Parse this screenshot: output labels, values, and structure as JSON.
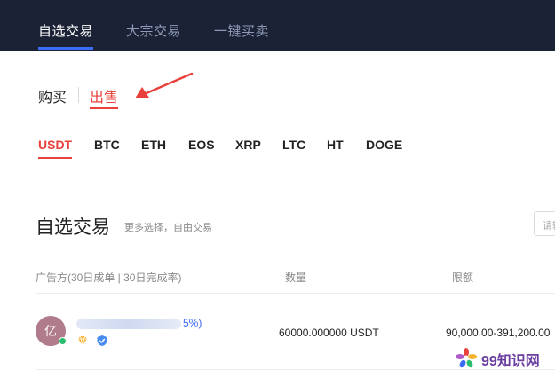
{
  "top_nav": {
    "tabs": [
      {
        "label": "自选交易",
        "active": true
      },
      {
        "label": "大宗交易",
        "active": false
      },
      {
        "label": "一键买卖",
        "active": false
      }
    ]
  },
  "trade_toggle": {
    "buy_label": "购买",
    "sell_label": "出售",
    "selected": "出售"
  },
  "coins": [
    {
      "label": "USDT",
      "active": true
    },
    {
      "label": "BTC",
      "active": false
    },
    {
      "label": "ETH",
      "active": false
    },
    {
      "label": "EOS",
      "active": false
    },
    {
      "label": "XRP",
      "active": false
    },
    {
      "label": "LTC",
      "active": false
    },
    {
      "label": "HT",
      "active": false
    },
    {
      "label": "DOGE",
      "active": false
    }
  ],
  "section": {
    "title": "自选交易",
    "subtitle": "更多选择，自由交易",
    "search_placeholder": "请输"
  },
  "table": {
    "headers": [
      "广告方(30日成单 | 30日完成率)",
      "数量",
      "限额"
    ],
    "rows": [
      {
        "avatar_text": "亿",
        "merchant_visible": "5%)",
        "quantity": "60000.000000 USDT",
        "limit": "90,000.00-391,200.00"
      }
    ]
  },
  "watermark": {
    "text": "99知识网"
  },
  "colors": {
    "nav_bg": "#1b2236",
    "accent_red": "#e8403b",
    "accent_blue": "#3b6cf6"
  }
}
